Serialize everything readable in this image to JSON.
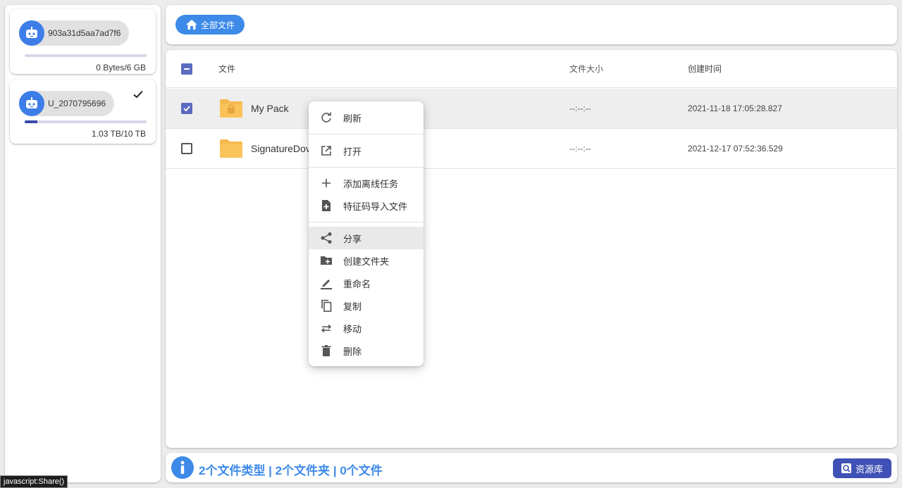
{
  "sidebar": {
    "accounts": [
      {
        "name": "903a31d5aa7ad7f6",
        "usage": "0 Bytes/6 GB",
        "usage_fraction": 0.0,
        "active": false
      },
      {
        "name": "U_2070795696",
        "usage": "1.03 TB/10 TB",
        "usage_fraction": 0.103,
        "active": true
      }
    ]
  },
  "topbar": {
    "home_label": "全部文件"
  },
  "table": {
    "columns": {
      "name": "文件",
      "size": "文件大小",
      "created": "创建时间"
    },
    "rows": [
      {
        "name": "My Pack",
        "size": "--:--:--",
        "created": "2021-11-18 17:05:28.827",
        "checked": true
      },
      {
        "name": "SignatureDov",
        "size": "--:--:--",
        "created": "2021-12-17 07:52:36.529",
        "checked": false
      }
    ]
  },
  "context_menu": {
    "refresh": "刷新",
    "open": "打开",
    "add_offline": "添加离线任务",
    "import_by_code": "特征码导入文件",
    "share": "分享",
    "create_folder": "创建文件夹",
    "rename": "重命名",
    "copy": "复制",
    "move": "移动",
    "delete": "删除"
  },
  "bottombar": {
    "summary": "2个文件类型 | 2个文件夹 | 0个文件",
    "library_label": "资源库"
  },
  "statusbar": {
    "text": "javascript:Share()"
  },
  "colors": {
    "accent": "#3d8ae8",
    "indigo": "#3f51b5",
    "checkbox": "#5c6bc0",
    "folder": "#f7b84b"
  }
}
